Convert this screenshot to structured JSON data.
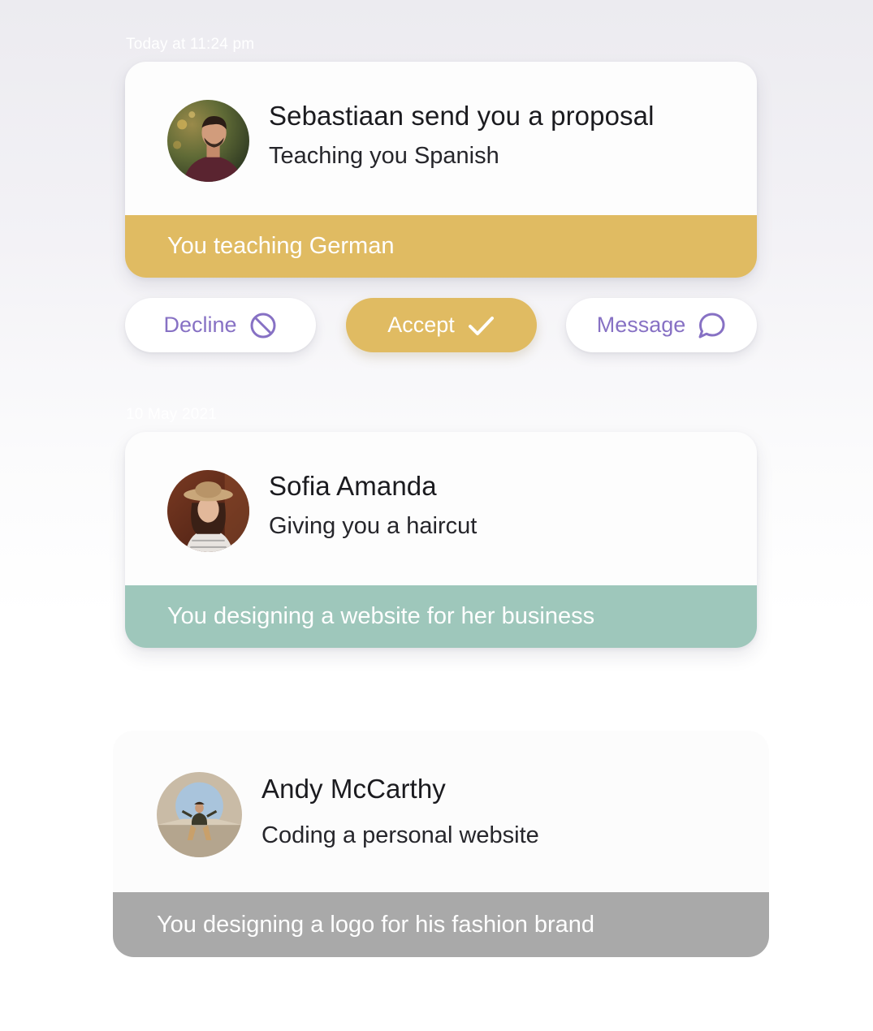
{
  "notifications": [
    {
      "timestamp": "Today at 11:24 pm",
      "name": "Sebastiaan send you a proposal",
      "description": "Teaching you Spanish",
      "exchange": "You teaching German",
      "exchange_color": "#e0bb62",
      "avatar_icon": "man-portrait-photo"
    },
    {
      "timestamp": "10 May 2021",
      "name": "Sofia Amanda",
      "description": "Giving you a haircut",
      "exchange": "You designing a website for her business",
      "exchange_color": "#9ec7bb",
      "avatar_icon": "woman-portrait-photo"
    },
    {
      "name": "Andy McCarthy",
      "description": "Coding a personal website",
      "exchange": "You designing a logo for his fashion brand",
      "exchange_color": "#a9a9a9",
      "avatar_icon": "man-sitting-photo"
    }
  ],
  "actions": {
    "decline": {
      "label": "Decline",
      "icon": "block-icon"
    },
    "accept": {
      "label": "Accept",
      "icon": "check-icon"
    },
    "message": {
      "label": "Message",
      "icon": "chat-bubble-icon"
    }
  },
  "colors": {
    "accent_gold": "#e0bb62",
    "accent_purple": "#8771c4",
    "accent_teal": "#9ec7bb"
  }
}
